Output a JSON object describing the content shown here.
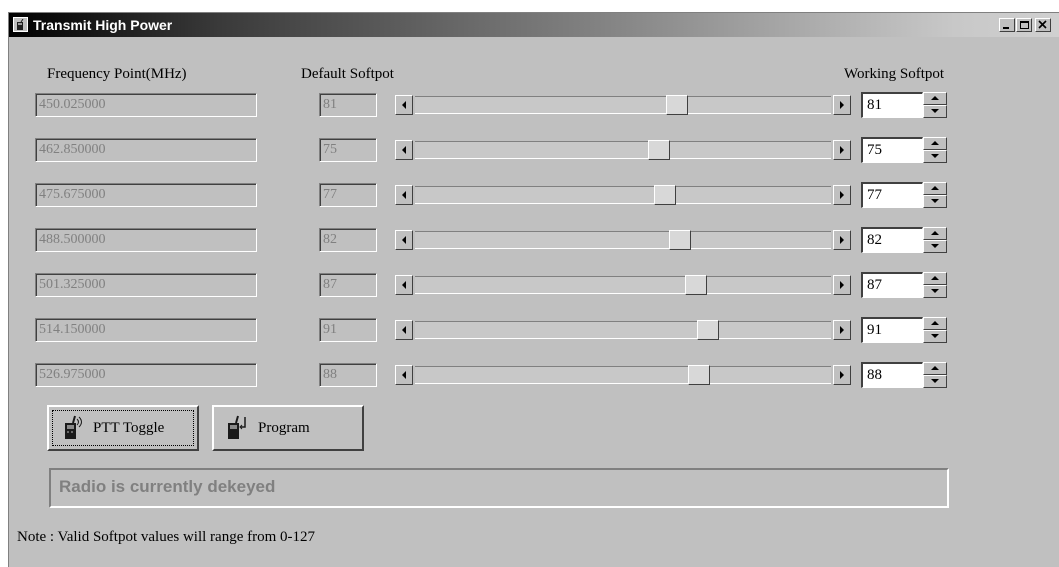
{
  "window": {
    "title": "Transmit High Power",
    "title_icon": "radio-app-icon",
    "controls": [
      "minimize-icon",
      "maximize-icon",
      "close-icon"
    ],
    "titlebar_colors": [
      "#000000",
      "#d0d0d0"
    ]
  },
  "headers": {
    "frequency": "Frequency Point(MHz)",
    "default": "Default Softpot",
    "working": "Working Softpot"
  },
  "softpot": {
    "min": 0,
    "max": 127
  },
  "rows": [
    {
      "frequency": "450.025000",
      "default": "81",
      "working": "81",
      "slider": 81
    },
    {
      "frequency": "462.850000",
      "default": "75",
      "working": "75",
      "slider": 75
    },
    {
      "frequency": "475.675000",
      "default": "77",
      "working": "77",
      "slider": 77
    },
    {
      "frequency": "488.500000",
      "default": "82",
      "working": "82",
      "slider": 82
    },
    {
      "frequency": "501.325000",
      "default": "87",
      "working": "87",
      "slider": 87
    },
    {
      "frequency": "514.150000",
      "default": "91",
      "working": "91",
      "slider": 91
    },
    {
      "frequency": "526.975000",
      "default": "88",
      "working": "88",
      "slider": 88
    }
  ],
  "buttons": {
    "ptt_toggle": "PTT Toggle",
    "program": "Program"
  },
  "status": "Radio is currently dekeyed",
  "note": "Note : Valid Softpot values will range from 0-127",
  "colors": {
    "face": "#c0c0c0",
    "disabled_text": "#808080"
  }
}
